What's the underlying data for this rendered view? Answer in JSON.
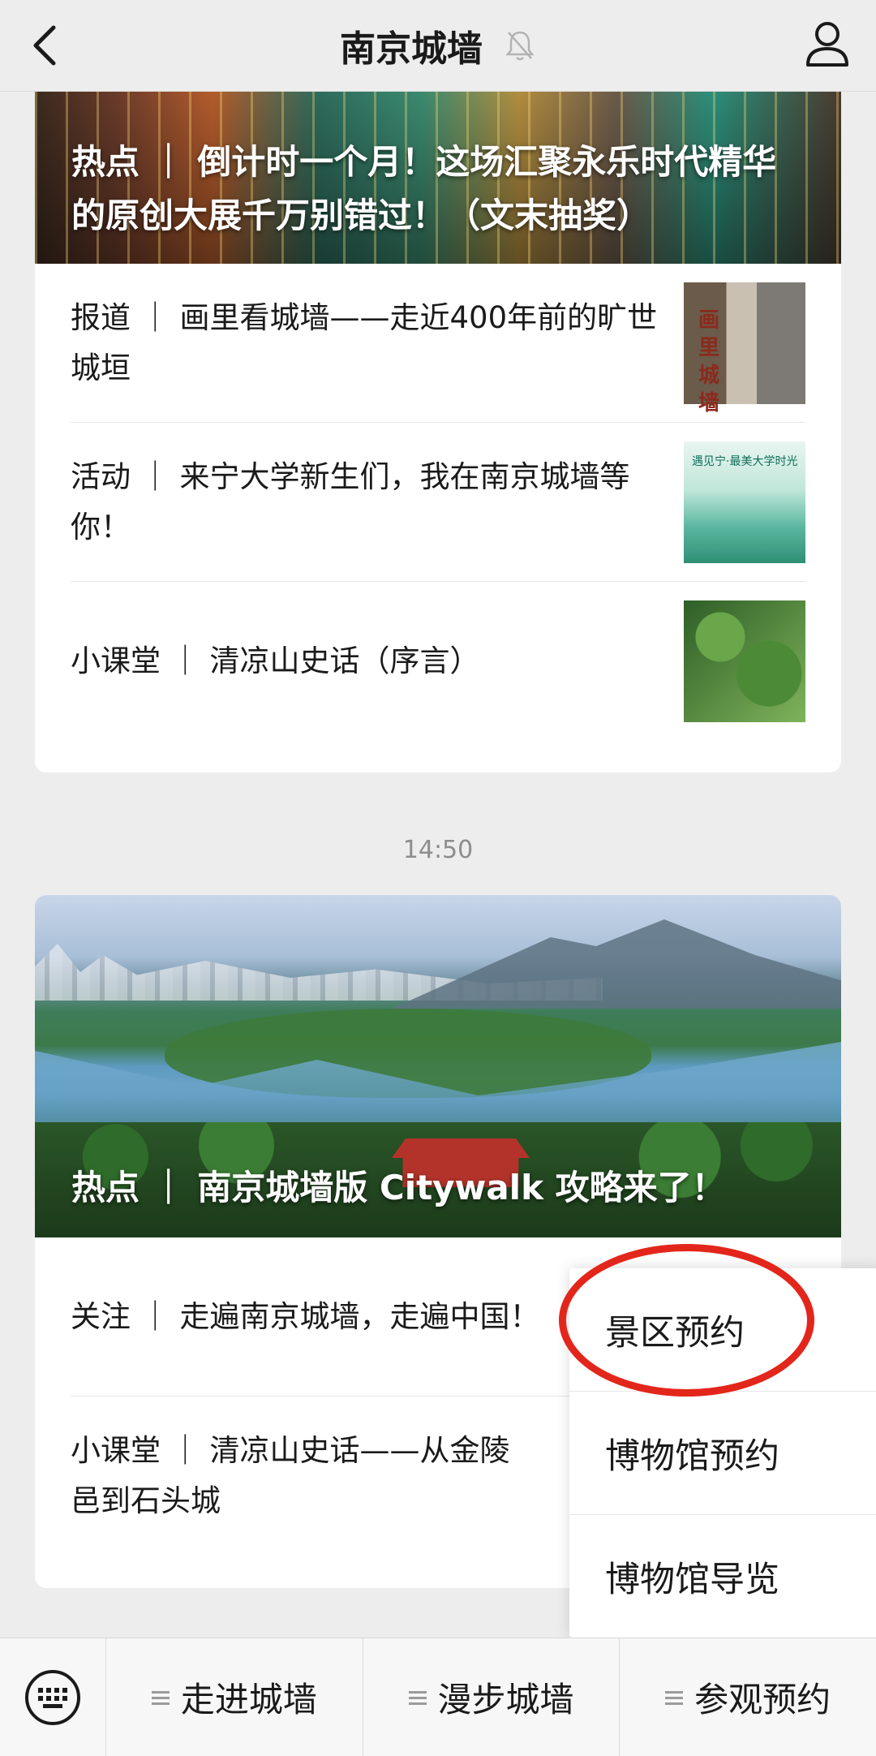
{
  "header": {
    "title": "南京城墙"
  },
  "card1": {
    "hero_title": "热点 ｜ 倒计时一个月！这场汇聚永乐时代精华的原创大展千万别错过！（文末抽奖）",
    "items": [
      {
        "title": "报道 ｜ 画里看城墙——走近400年前的旷世城垣",
        "thumb_text": "画里城墙"
      },
      {
        "title": "活动 ｜ 来宁大学新生们，我在南京城墙等你！",
        "thumb_text": "遇见宁·最美大学时光"
      },
      {
        "title": "小课堂 ｜ 清凉山史话（序言）"
      }
    ]
  },
  "timestamp": "14:50",
  "card2": {
    "hero_title": "热点 ｜ 南京城墙版 Citywalk 攻略来了！",
    "items": [
      {
        "title": "关注 ｜ 走遍南京城墙，走遍中国！"
      },
      {
        "title": "小课堂 ｜ 清凉山史话——从金陵邑到石头城"
      }
    ]
  },
  "popup_menu": {
    "items": [
      "景区预约",
      "博物馆预约",
      "博物馆导览"
    ],
    "highlighted": "景区预约",
    "highlight_color": "#e3261b"
  },
  "menubar": {
    "tabs": [
      "走进城墙",
      "漫步城墙",
      "参观预约"
    ]
  }
}
